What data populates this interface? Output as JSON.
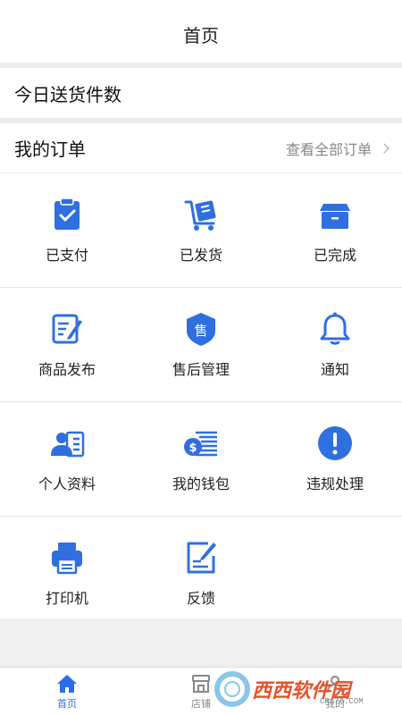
{
  "header": {
    "title": "首页"
  },
  "today_row": {
    "label": "今日送货件数"
  },
  "orders": {
    "title": "我的订单",
    "view_all": "查看全部订单"
  },
  "grid": [
    [
      {
        "label": "已支付",
        "icon": "clipboard-check-icon"
      },
      {
        "label": "已发货",
        "icon": "cart-shipping-icon"
      },
      {
        "label": "已完成",
        "icon": "box-icon"
      }
    ],
    [
      {
        "label": "商品发布",
        "icon": "edit-document-icon"
      },
      {
        "label": "售后管理",
        "icon": "shield-badge-icon",
        "badge_text": "售"
      },
      {
        "label": "通知",
        "icon": "bell-icon"
      }
    ],
    [
      {
        "label": "个人资料",
        "icon": "id-card-icon"
      },
      {
        "label": "我的钱包",
        "icon": "wallet-coin-icon"
      },
      {
        "label": "违规处理",
        "icon": "alert-circle-icon"
      }
    ],
    [
      {
        "label": "打印机",
        "icon": "printer-icon"
      },
      {
        "label": "反馈",
        "icon": "feedback-edit-icon"
      }
    ]
  ],
  "tabbar": [
    {
      "label": "首页",
      "icon": "home-icon",
      "active": true
    },
    {
      "label": "店铺",
      "icon": "store-icon",
      "active": false
    },
    {
      "label": "我的",
      "icon": "user-icon",
      "active": false
    }
  ],
  "watermark": {
    "text": "西西软件园",
    "sub": "CR173.COM"
  },
  "colors": {
    "accent": "#2b6de8",
    "icon_blue": "#2f6fe0",
    "text": "#222222",
    "muted": "#888888",
    "divider": "#e6e6e6"
  }
}
